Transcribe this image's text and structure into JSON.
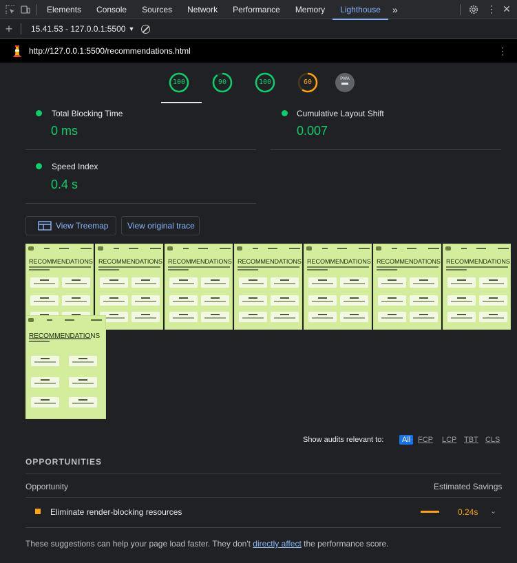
{
  "devtools": {
    "tabs": [
      "Elements",
      "Console",
      "Sources",
      "Network",
      "Performance",
      "Memory",
      "Lighthouse"
    ],
    "active_tab": "Lighthouse",
    "overflow": "»"
  },
  "report": {
    "selector": "15.41.53 - 127.0.0.1:5500",
    "url": "http://127.0.0.1:5500/recommendations.html"
  },
  "gauges": [
    {
      "label": "100",
      "score": 100,
      "color": "#0cce6b"
    },
    {
      "label": "90",
      "score": 90,
      "color": "#0cce6b"
    },
    {
      "label": "100",
      "score": 100,
      "color": "#0cce6b"
    },
    {
      "label": "60",
      "score": 60,
      "color": "#ffa400"
    },
    {
      "label": "PWA",
      "score": 0,
      "color": "#9aa0a6"
    }
  ],
  "metrics": [
    {
      "title": "Total Blocking Time",
      "value": "0 ms"
    },
    {
      "title": "Cumulative Layout Shift",
      "value": "0.007"
    },
    {
      "title": "Speed Index",
      "value": "0.4 s"
    }
  ],
  "buttons": {
    "treemap": "View Treemap",
    "trace": "View original trace"
  },
  "thumbnail": {
    "title": "RECOMMENDATIONS"
  },
  "filter": {
    "label": "Show audits relevant to:",
    "chips": [
      "All",
      "FCP",
      "LCP",
      "TBT",
      "CLS"
    ]
  },
  "opportunities": {
    "section_title": "OPPORTUNITIES",
    "col_opportunity": "Opportunity",
    "col_savings": "Estimated Savings",
    "items": [
      {
        "label": "Eliminate render-blocking resources",
        "savings": "0.24s"
      }
    ]
  },
  "footer": {
    "before": "These suggestions can help your page load faster. They don't ",
    "link": "directly affect",
    "after": " the performance score."
  },
  "colors": {
    "pass": "#0cce6b",
    "average": "#ffa400",
    "link": "#8ab4f8",
    "background": "#202124"
  }
}
